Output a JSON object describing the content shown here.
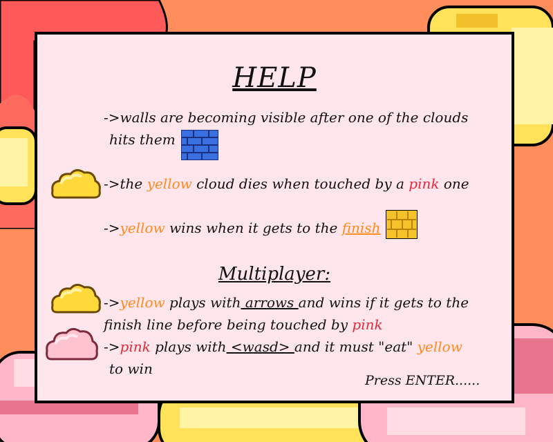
{
  "help": {
    "title": "HELP",
    "walls_1": "->walls are becoming visible after one of the clouds",
    "walls_2": "hits them",
    "dies_a": "->the ",
    "dies_yellow": "yellow",
    "dies_b": " cloud dies when touched by a ",
    "dies_pink": "pink",
    "dies_c": " one",
    "wins_a": "->",
    "wins_yellow": "yellow",
    "wins_b": " wins when it gets to the ",
    "wins_finish": "finish"
  },
  "multiplayer": {
    "heading": "Multiplayer:",
    "y1_a": "->",
    "y1_yellow": "yellow",
    "y1_b": " plays with",
    "y1_arrows": " arrows ",
    "y1_c": "and wins if it gets to the",
    "y2_a": "finish line before being touched by ",
    "y2_pink": "pink",
    "p1_a": "->",
    "p1_pink": "pink",
    "p1_b": " plays with",
    "p1_wasd": " <wasd> ",
    "p1_c": " and it must \"eat\" ",
    "p1_yellow": "yellow",
    "p2": "to win"
  },
  "footer": {
    "press_enter": "Press ENTER......"
  },
  "colors": {
    "yellow": "#ff8a1e",
    "pink": "#e8283a",
    "panel": "#ffe6ec",
    "background": "#ff8e5c"
  }
}
